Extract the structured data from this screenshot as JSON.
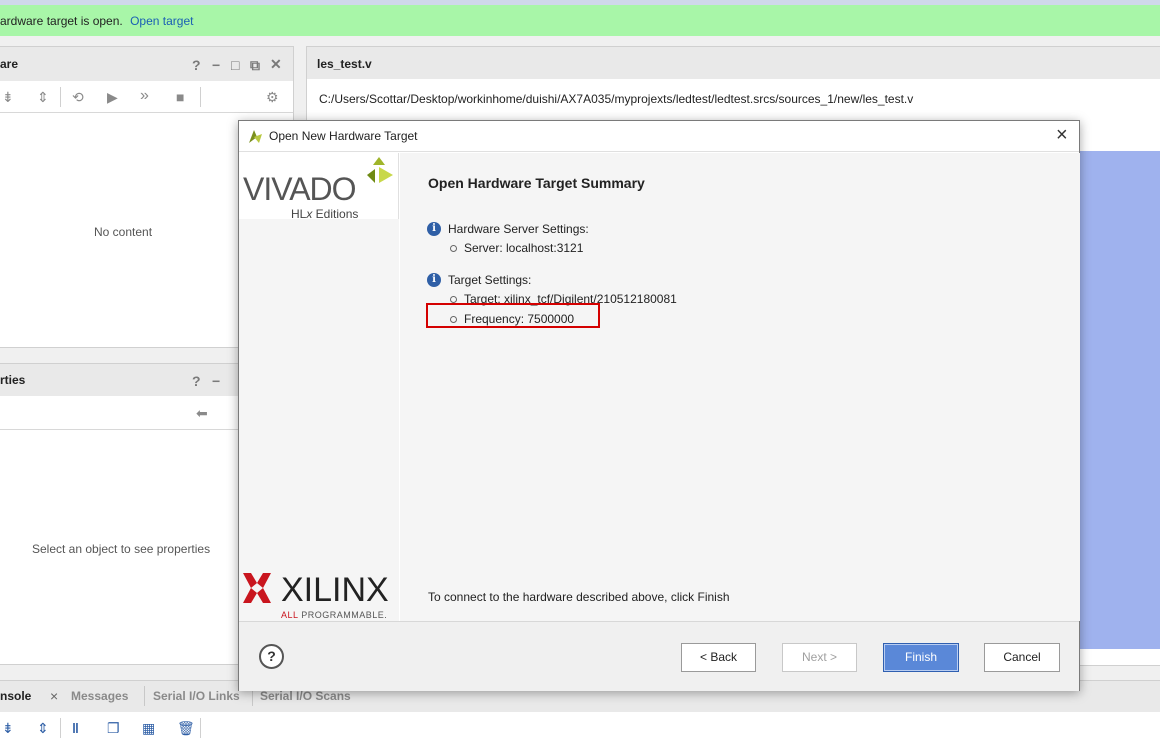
{
  "banner": {
    "message": "ardware target is open.",
    "link": "Open target"
  },
  "hardware_panel": {
    "title": "are",
    "help": "?",
    "empty_text": "No content"
  },
  "properties_panel": {
    "title": "rties",
    "help": "?",
    "empty_text": "Select an object to see properties"
  },
  "editor": {
    "tab_title": "les_test.v",
    "path": "C:/Users/Scottar/Desktop/workinhome/duishi/AX7A035/myprojexts/ledtest/ledtest.srcs/sources_1/new/les_test.v"
  },
  "bottom_tabs": {
    "console": "nsole",
    "close": "×",
    "messages": "Messages",
    "serial_links": "Serial I/O Links",
    "serial_scans": "Serial I/O Scans"
  },
  "dialog": {
    "title": "Open New Hardware Target",
    "close": "×",
    "heading": "Open Hardware Target Summary",
    "logo_vivado": "VIVADO",
    "logo_hlx_prefix": "HL",
    "logo_hlx_x": "x",
    "logo_hlx_suffix": " Editions",
    "logo_xilinx": "XILINX",
    "logo_all": "ALL ",
    "logo_programmable": "PROGRAMMABLE.",
    "hw_server_label": "Hardware Server Settings:",
    "server_value": "Server: localhost:3121",
    "target_label": "Target Settings:",
    "target_value": "Target: xilinx_tcf/Digilent/210512180081",
    "frequency_value": "Frequency: 7500000",
    "footer_text": "To connect to the hardware described above, click Finish",
    "help_btn": "?",
    "back_btn": "< Back",
    "next_btn": "Next >",
    "finish_btn": "Finish",
    "cancel_btn": "Cancel"
  },
  "colors": {
    "banner": "#a8f6a8",
    "accent": "#5a88d8",
    "highlight_box": "#d40000",
    "side_panel": "#9fb2ee"
  }
}
